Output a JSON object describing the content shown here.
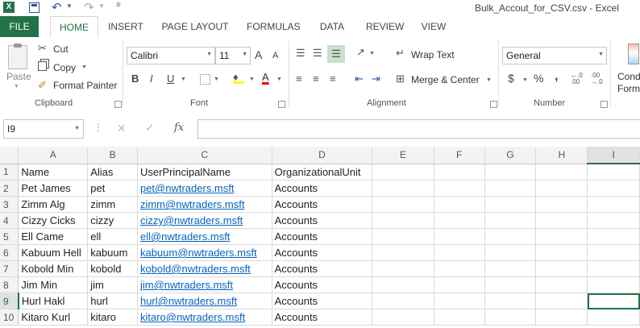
{
  "window": {
    "title": "Bulk_Accout_for_CSV.csv - Excel"
  },
  "quick_access": {
    "save_icon": "save-icon",
    "undo_icon": "undo-icon",
    "redo_icon": "redo-icon"
  },
  "tabs": [
    "FILE",
    "HOME",
    "INSERT",
    "PAGE LAYOUT",
    "FORMULAS",
    "DATA",
    "REVIEW",
    "VIEW"
  ],
  "ribbon": {
    "clipboard": {
      "paste": "Paste",
      "cut": "Cut",
      "copy": "Copy",
      "format_painter": "Format Painter",
      "label": "Clipboard"
    },
    "font": {
      "name": "Calibri",
      "size": "11",
      "label": "Font",
      "bold": "B",
      "italic": "I",
      "underline": "U",
      "grow": "A",
      "shrink": "A"
    },
    "alignment": {
      "wrap_text": "Wrap Text",
      "merge_center": "Merge & Center",
      "label": "Alignment"
    },
    "number": {
      "format": "General",
      "currency": "$",
      "percent": "%",
      "comma": ",",
      "label": "Number",
      "inc_decimal": ".0← .00",
      "dec_decimal": ".00 →.0"
    },
    "styles": {
      "conditional": "Cond",
      "format_as": "Forma"
    }
  },
  "formula_bar": {
    "name_box": "I9",
    "fx": "fx",
    "value": ""
  },
  "columns": [
    "A",
    "B",
    "C",
    "D",
    "E",
    "F",
    "G",
    "H",
    "I"
  ],
  "selected": {
    "column": "I",
    "row": "9"
  },
  "rows": [
    {
      "n": "1",
      "cells": [
        "Name",
        "Alias",
        "UserPrincipalName",
        "OrganizationalUnit"
      ]
    },
    {
      "n": "2",
      "cells": [
        "Pet James",
        "pet",
        "pet@nwtraders.msft",
        "Accounts"
      ]
    },
    {
      "n": "3",
      "cells": [
        "Zimm Alg",
        "zimm",
        "zimm@nwtraders.msft",
        "Accounts"
      ]
    },
    {
      "n": "4",
      "cells": [
        "Cizzy Cicks",
        "cizzy",
        "cizzy@nwtraders.msft",
        "Accounts"
      ]
    },
    {
      "n": "5",
      "cells": [
        "Ell Came",
        "ell",
        "ell@nwtraders.msft",
        "Accounts"
      ]
    },
    {
      "n": "6",
      "cells": [
        "Kabuum Hell",
        "kabuum",
        "kabuum@nwtraders.msft",
        "Accounts"
      ]
    },
    {
      "n": "7",
      "cells": [
        "Kobold Min",
        "kobold",
        "kobold@nwtraders.msft",
        "Accounts"
      ]
    },
    {
      "n": "8",
      "cells": [
        "Jim Min",
        "jim",
        "jim@nwtraders.msft",
        "Accounts"
      ]
    },
    {
      "n": "9",
      "cells": [
        "Hurl Hakl",
        "hurl",
        "hurl@nwtraders.msft",
        "Accounts"
      ]
    },
    {
      "n": "10",
      "cells": [
        "Kitaro Kurl",
        "kitaro",
        "kitaro@nwtraders.msft",
        "Accounts"
      ]
    }
  ]
}
